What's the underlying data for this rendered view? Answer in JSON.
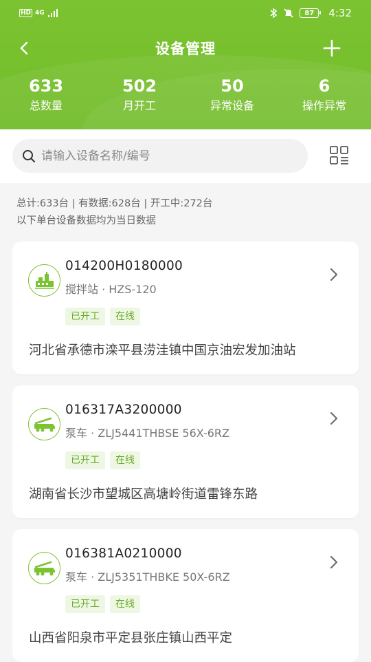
{
  "status_bar": {
    "hd_label": "HD",
    "net_label": "4G",
    "battery": "87",
    "time": "4:32"
  },
  "header": {
    "title": "设备管理",
    "back_icon": "chevron-left-icon",
    "add_icon": "plus-icon",
    "bg_color": "#78c12e"
  },
  "stats": [
    {
      "value": "633",
      "label": "总数量"
    },
    {
      "value": "502",
      "label": "月开工"
    },
    {
      "value": "50",
      "label": "异常设备"
    },
    {
      "value": "6",
      "label": "操作异常"
    }
  ],
  "search": {
    "placeholder": "请输入设备名称/编号",
    "value": ""
  },
  "summary": {
    "line1": "总计:633台 | 有数据:628台 | 开工中:272台",
    "line2": "以下单台设备数据均为当日数据"
  },
  "devices": [
    {
      "id": "014200H0180000",
      "type": "搅拌站 · HZS-120",
      "icon": "mixing-station-icon",
      "tags": [
        "已开工",
        "在线"
      ],
      "address": "河北省承德市滦平县涝洼镇中国京油宏发加油站"
    },
    {
      "id": "016317A3200000",
      "type": "泵车 · ZLJ5441THBSE 56X-6RZ",
      "icon": "pump-truck-icon",
      "tags": [
        "已开工",
        "在线"
      ],
      "address": "湖南省长沙市望城区高塘岭街道雷锋东路"
    },
    {
      "id": "016381A0210000",
      "type": "泵车 · ZLJ5351THBKE 50X-6RZ",
      "icon": "pump-truck-icon",
      "tags": [
        "已开工",
        "在线"
      ],
      "address": "山西省阳泉市平定县张庄镇山西平定"
    }
  ],
  "colors": {
    "accent": "#7cc331",
    "tag_bg": "#eef7e4",
    "tag_text": "#6aaa25"
  }
}
